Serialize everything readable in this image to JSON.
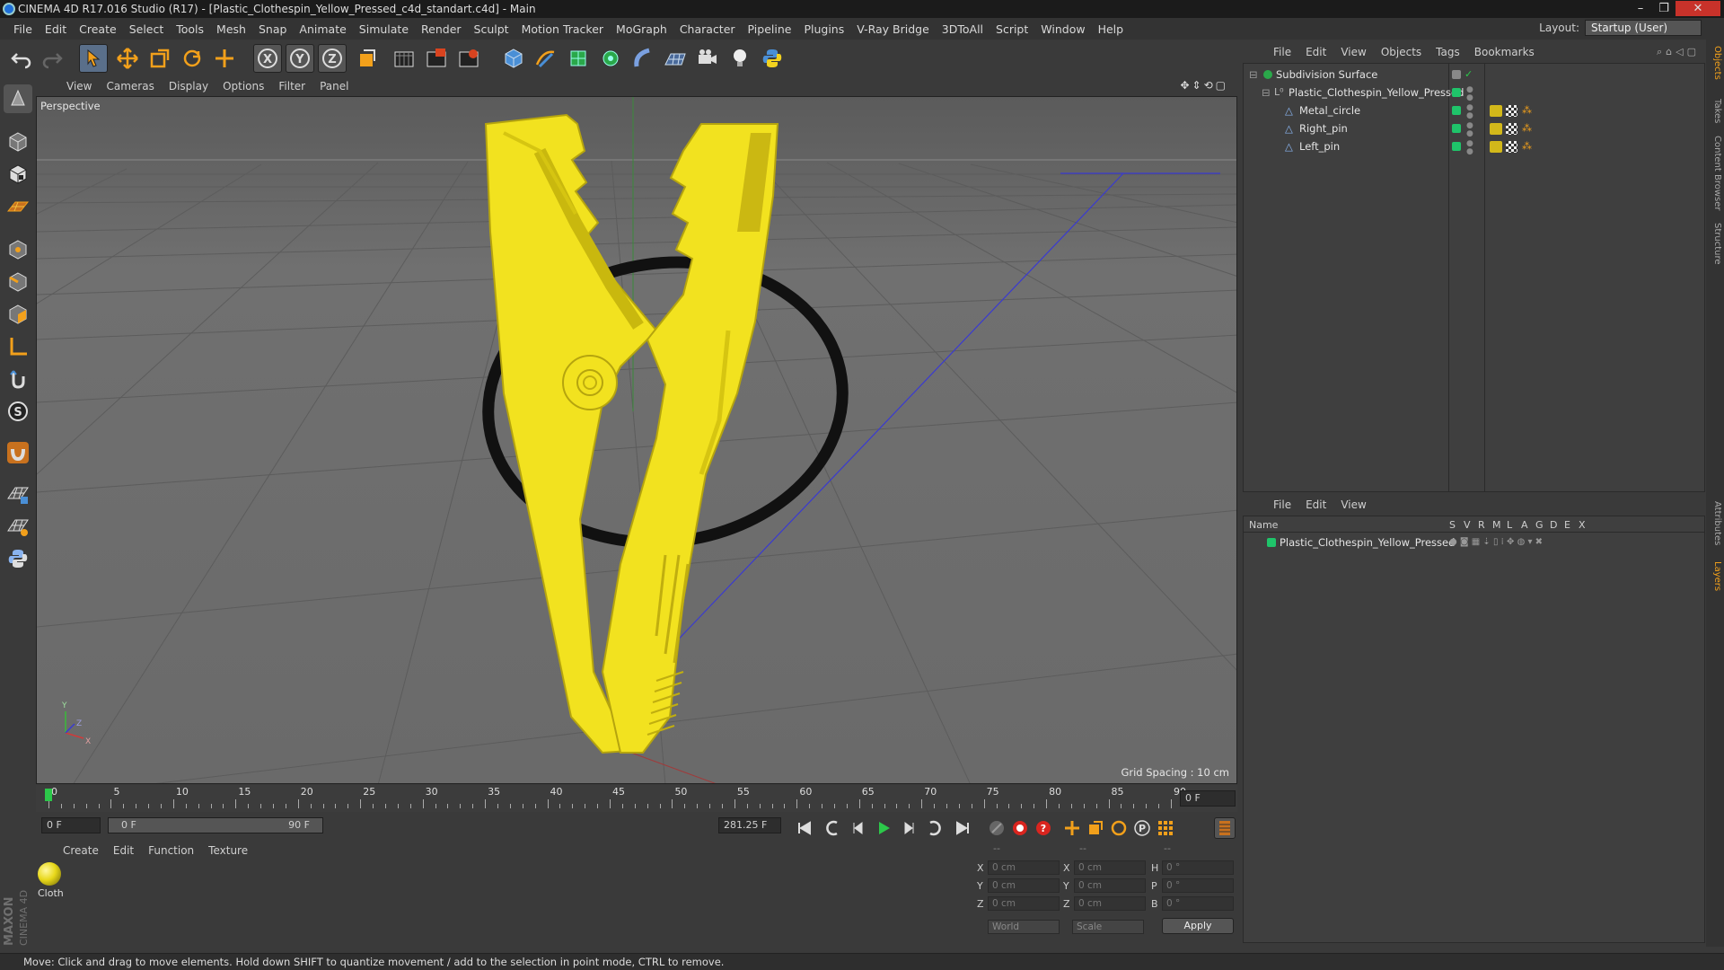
{
  "title": "CINEMA 4D R17.016 Studio (R17) - [Plastic_Clothespin_Yellow_Pressed_c4d_standart.c4d] - Main",
  "menu": [
    "File",
    "Edit",
    "Create",
    "Select",
    "Tools",
    "Mesh",
    "Snap",
    "Animate",
    "Simulate",
    "Render",
    "Sculpt",
    "Motion Tracker",
    "MoGraph",
    "Character",
    "Pipeline",
    "Plugins",
    "V-Ray Bridge",
    "3DToAll",
    "Script",
    "Window",
    "Help"
  ],
  "layout": {
    "label": "Layout:",
    "value": "Startup (User)"
  },
  "viewport": {
    "menu": [
      "View",
      "Cameras",
      "Display",
      "Options",
      "Filter",
      "Panel"
    ],
    "label": "Perspective",
    "grid_spacing": "Grid Spacing : 10 cm"
  },
  "timeline": {
    "ticks": [
      "0",
      "5",
      "10",
      "15",
      "20",
      "25",
      "30",
      "35",
      "40",
      "45",
      "50",
      "55",
      "60",
      "65",
      "70",
      "75",
      "80",
      "85",
      "90"
    ],
    "end_field": "0 F",
    "start_field": "0 F",
    "range_start": "0 F",
    "range_end": "90 F",
    "current_field": "281.25 F"
  },
  "materials": {
    "menu": [
      "Create",
      "Edit",
      "Function",
      "Texture"
    ],
    "items": [
      {
        "label": "Cloth"
      }
    ]
  },
  "coords": {
    "header": [
      "--",
      "--",
      "--"
    ],
    "rows": [
      {
        "a": "X",
        "av": "0 cm",
        "b": "X",
        "bv": "0 cm",
        "c": "H",
        "cv": "0 °"
      },
      {
        "a": "Y",
        "av": "0 cm",
        "b": "Y",
        "bv": "0 cm",
        "c": "P",
        "cv": "0 °"
      },
      {
        "a": "Z",
        "av": "0 cm",
        "b": "Z",
        "bv": "0 cm",
        "c": "B",
        "cv": "0 °"
      }
    ],
    "mode1": "World",
    "mode2": "Scale",
    "apply": "Apply"
  },
  "objects": {
    "menu": [
      "File",
      "Edit",
      "View",
      "Objects",
      "Tags",
      "Bookmarks"
    ],
    "items": [
      {
        "name": "Subdivision Surface",
        "level": 0
      },
      {
        "name": "Plastic_Clothespin_Yellow_Pressed",
        "level": 1
      },
      {
        "name": "Metal_circle",
        "level": 2
      },
      {
        "name": "Right_pin",
        "level": 2
      },
      {
        "name": "Left_pin",
        "level": 2
      }
    ]
  },
  "layers": {
    "menu": [
      "File",
      "Edit",
      "View"
    ],
    "col_name": "Name",
    "cols": [
      "S",
      "V",
      "R",
      "M",
      "L",
      "A",
      "G",
      "D",
      "E",
      "X"
    ],
    "items": [
      {
        "name": "Plastic_Clothespin_Yellow_Pressed"
      }
    ]
  },
  "right_tabs": [
    "Objects",
    "Takes",
    "Content Browser",
    "Structure",
    "Attributes",
    "Layers"
  ],
  "status": "Move: Click and drag to move elements. Hold down SHIFT to quantize movement / add to the selection in point mode, CTRL to remove.",
  "maxon": {
    "line1": "MAXON",
    "line2": "CINEMA 4D"
  },
  "colors": {
    "accent": "#4a8fd6",
    "object_yellow": "#f2e21f",
    "layer_green": "#1fc46a"
  }
}
